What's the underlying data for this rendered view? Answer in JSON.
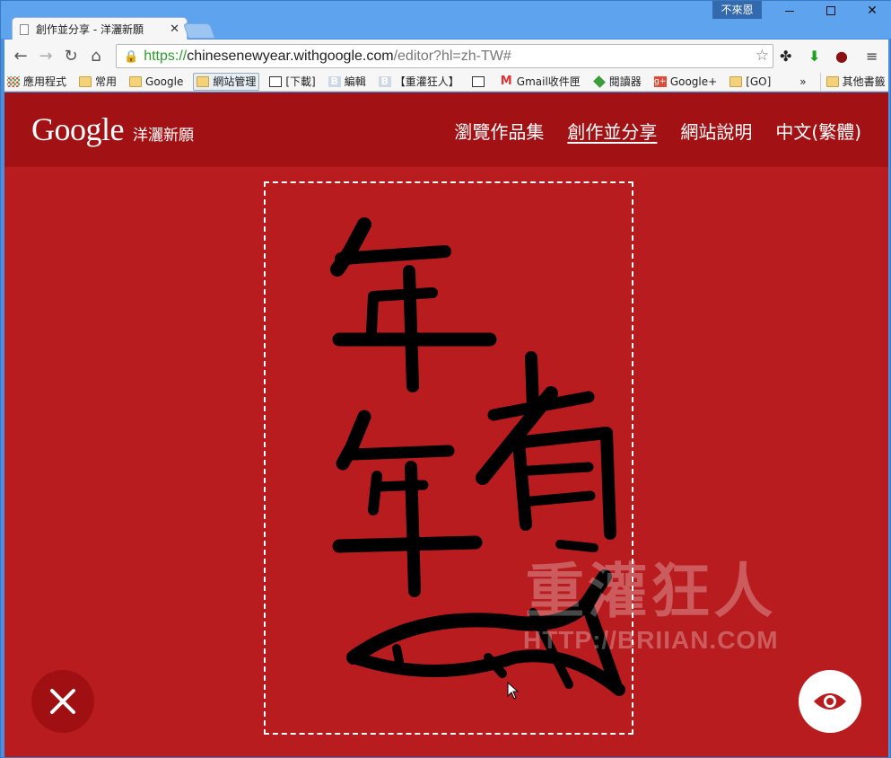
{
  "browser": {
    "tab_title": "創作並分享 - 洋灑新願",
    "profile_label": "不來恩",
    "url_scheme": "https://",
    "url_host": "chinesenewyear.withgoogle.com",
    "url_path": "/editor?hl=zh-TW#"
  },
  "bookmarks": [
    {
      "label": "應用程式",
      "icon": "apps-grid-icon"
    },
    {
      "label": "常用",
      "icon": "folder-icon"
    },
    {
      "label": "Google",
      "icon": "folder-icon"
    },
    {
      "label": "網站管理",
      "icon": "folder-icon"
    },
    {
      "label": "[下載]",
      "icon": "page-icon"
    },
    {
      "label": "編輯",
      "icon": "blogger-icon"
    },
    {
      "label": "【重灌狂人】",
      "icon": "blogger-icon"
    },
    {
      "label": "",
      "icon": "page-icon"
    },
    {
      "label": "Gmail收件匣",
      "icon": "gmail-icon"
    },
    {
      "label": "閱讀器",
      "icon": "feedly-icon"
    },
    {
      "label": "Google+",
      "icon": "google-plus-icon"
    },
    {
      "label": "[GO]",
      "icon": "folder-icon"
    }
  ],
  "bookmarks_overflow": "»",
  "bookmarks_other": "其他書籤",
  "site": {
    "logo_text": "Google",
    "logo_subtitle": "洋灑新願",
    "nav": [
      {
        "label": "瀏覽作品集",
        "current": false
      },
      {
        "label": "創作並分享",
        "current": true
      },
      {
        "label": "網站說明",
        "current": false
      },
      {
        "label": "中文(繁體)",
        "current": false
      }
    ]
  },
  "watermark": {
    "main": "重灌狂人",
    "url": "HTTP://BRIIAN.COM"
  },
  "colors": {
    "page_bg": "#b81c1e",
    "header_bg": "#a21114",
    "clear_btn": "#a01013"
  }
}
